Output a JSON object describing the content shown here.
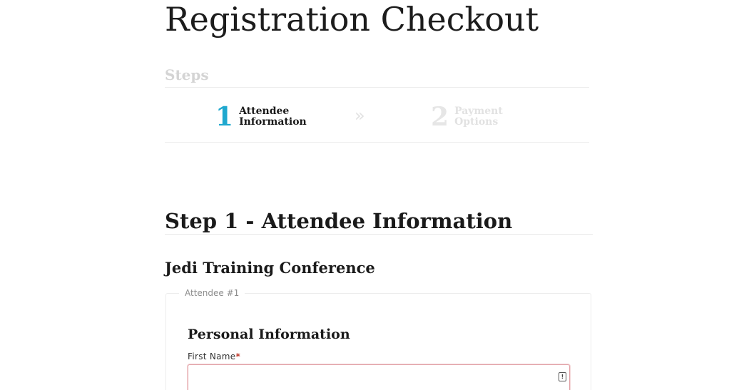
{
  "page": {
    "title": "Registration Checkout"
  },
  "steps": {
    "heading": "Steps",
    "separator": "»",
    "items": [
      {
        "number": "1",
        "label": "Attendee Information",
        "active": true
      },
      {
        "number": "2",
        "label": "Payment Options",
        "active": false
      }
    ],
    "active_color": "#1fa8cf"
  },
  "main": {
    "section_title": "Step 1 - Attendee Information",
    "event_name": "Jedi Training Conference",
    "attendee": {
      "legend": "Attendee #1",
      "group_heading": "Personal Information",
      "fields": [
        {
          "label": "First Name",
          "required_marker": "*",
          "value": "",
          "icon": "autofill-contact-icon"
        }
      ]
    }
  }
}
